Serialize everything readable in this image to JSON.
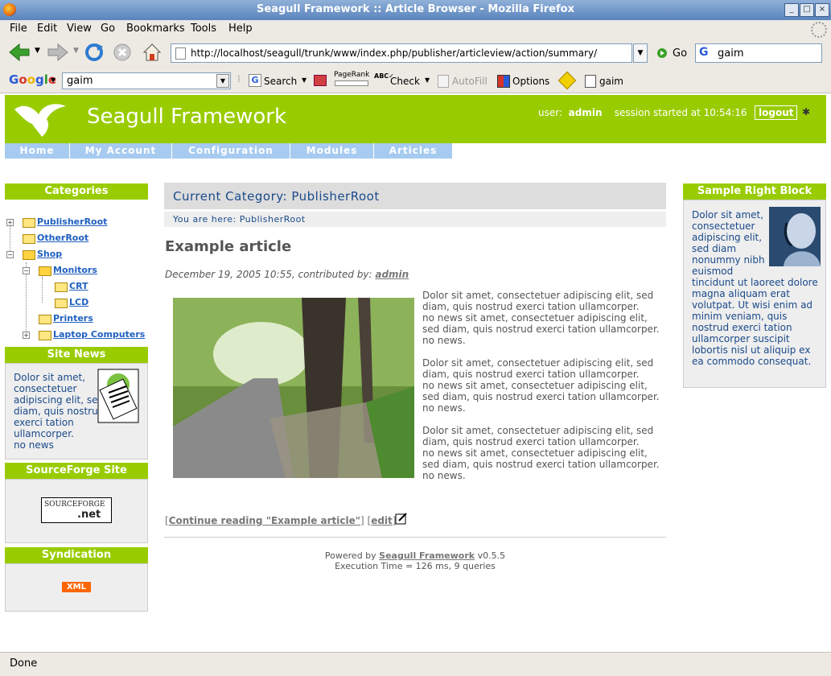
{
  "window": {
    "title": "Seagull Framework :: Article Browser - Mozilla Firefox"
  },
  "menu": [
    "File",
    "Edit",
    "View",
    "Go",
    "Bookmarks",
    "Tools",
    "Help"
  ],
  "navbar": {
    "url": "http://localhost/seagull/trunk/www/index.php/publisher/articleview/action/summary/",
    "go_label": "Go",
    "search_value": "gaim"
  },
  "google_toolbar": {
    "logo": "Google",
    "query": "gaim",
    "search_label": "Search",
    "pagerank_label": "PageRank",
    "check_label": "Check",
    "autofill_label": "AutoFill",
    "options_label": "Options",
    "highlight_label": "gaim"
  },
  "site": {
    "brand": "Seagull Framework",
    "user_label": "user:",
    "user_name": "admin",
    "session_text": "session started at 10:54:16",
    "logout_label": "logout",
    "tabs": [
      "Home",
      "My Account",
      "Configuration",
      "Modules",
      "Articles"
    ]
  },
  "categories_block": {
    "title": "Categories",
    "items": [
      "PublisherRoot",
      "OtherRoot",
      "Shop",
      "Monitors",
      "CRT",
      "LCD",
      "Printers",
      "Laptop Computers"
    ]
  },
  "site_news": {
    "title": "Site News",
    "text": "Dolor sit amet, consectetuer adipiscing elit, sed diam, quis nostrud exerci tation ullamcorper.",
    "extra": "no news"
  },
  "sourceforge": {
    "title": "SourceForge Site",
    "logo_text": "SOURCEFORGE",
    "logo_suffix": ".net"
  },
  "syndication": {
    "title": "Syndication",
    "badge": "XML"
  },
  "main": {
    "category_title": "Current Category: PublisherRoot",
    "breadcrumb": "You are here: PublisherRoot",
    "article_title": "Example article",
    "article_meta": "December 19, 2005 10:55, contributed by:",
    "article_author": "admin",
    "paragraphs": [
      "Dolor sit amet, consectetuer adipiscing elit, sed diam, quis nostrud exerci tation ullamcorper.",
      "no news sit amet, consectetuer adipiscing elit, sed diam, quis nostrud exerci tation ullamcorper.",
      "no news."
    ],
    "continue_link": "Continue reading \"Example article\"",
    "edit_link": "edit",
    "footer_powered": "Powered by",
    "footer_link": "Seagull Framework",
    "footer_version": "v0.5.5",
    "footer_exec": "Execution Time = 126 ms, 9 queries"
  },
  "right_block": {
    "title": "Sample Right Block",
    "text": "Dolor sit amet, consectetuer adipiscing elit, sed diam nonummy nibh euismod tincidunt ut laoreet dolore magna aliquam erat volutpat. Ut wisi enim ad minim veniam, quis nostrud exerci tation ullamcorper suscipit lobortis nisl ut aliquip ex ea commodo consequat."
  },
  "statusbar": {
    "text": "Done"
  }
}
